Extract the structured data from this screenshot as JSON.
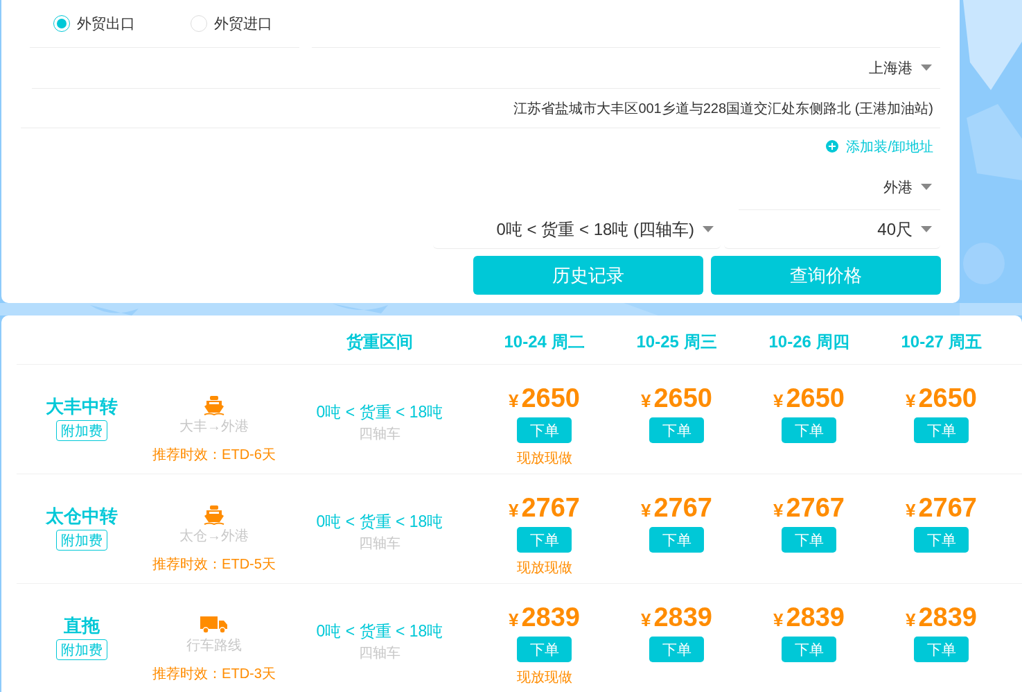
{
  "trade_type": [
    {
      "label": "外贸出口",
      "selected": true
    },
    {
      "label": "外贸进口",
      "selected": false
    }
  ],
  "port_select": {
    "value": "上海港"
  },
  "address": "江苏省盐城市大丰区001乡道与228国道交汇处东侧路北 (王港加油站)",
  "add_address_link": "添加装/卸地址",
  "destination_select": {
    "value": "外港"
  },
  "weight_select": {
    "value": "0吨 < 货重 < 18吨 (四轴车)"
  },
  "container_select": {
    "value": "40尺"
  },
  "buttons": [
    "历史记录",
    "查询价格"
  ],
  "table": {
    "columns": [
      "货重区间",
      "10-24 周二",
      "10-25 周三",
      "10-26 周四",
      "10-27 周五"
    ],
    "rows": [
      {
        "name": "大丰中转",
        "surcharge": "附加费",
        "kind": "ship",
        "route": "大丰→外港",
        "timing": "推荐时效：ETD-6天",
        "weight_range": "0吨 < 货重 < 18吨",
        "vehicle": "四轴车",
        "prices": [
          {
            "currency": "¥",
            "amount": "2650",
            "button": "下单",
            "note": "现放现做"
          },
          {
            "currency": "¥",
            "amount": "2650",
            "button": "下单"
          },
          {
            "currency": "¥",
            "amount": "2650",
            "button": "下单"
          },
          {
            "currency": "¥",
            "amount": "2650",
            "button": "下单"
          }
        ]
      },
      {
        "name": "太仓中转",
        "surcharge": "附加费",
        "kind": "ship",
        "route": "太仓→外港",
        "timing": "推荐时效：ETD-5天",
        "weight_range": "0吨 < 货重 < 18吨",
        "vehicle": "四轴车",
        "prices": [
          {
            "currency": "¥",
            "amount": "2767",
            "button": "下单",
            "note": "现放现做"
          },
          {
            "currency": "¥",
            "amount": "2767",
            "button": "下单"
          },
          {
            "currency": "¥",
            "amount": "2767",
            "button": "下单"
          },
          {
            "currency": "¥",
            "amount": "2767",
            "button": "下单"
          }
        ]
      },
      {
        "name": "直拖",
        "surcharge": "附加费",
        "kind": "truck",
        "route": "行车路线",
        "timing": "推荐时效：ETD-3天",
        "weight_range": "0吨 < 货重 < 18吨",
        "vehicle": "四轴车",
        "prices": [
          {
            "currency": "¥",
            "amount": "2839",
            "button": "下单",
            "note": "现放现做"
          },
          {
            "currency": "¥",
            "amount": "2839",
            "button": "下单"
          },
          {
            "currency": "¥",
            "amount": "2839",
            "button": "下单"
          },
          {
            "currency": "¥",
            "amount": "2839",
            "button": "下单"
          }
        ]
      }
    ]
  }
}
